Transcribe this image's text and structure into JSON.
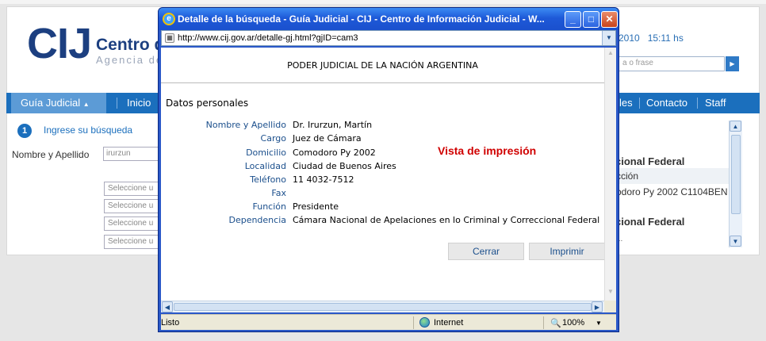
{
  "background": {
    "logo_mark": "CIJ",
    "logo_title": "Centro d",
    "logo_subtitle": "Agencia de",
    "date_partial": "2010",
    "time": "15:11 hs",
    "search_placeholder": "a o frase",
    "nav": {
      "active": "Guía Judicial",
      "items": [
        "Inicio",
        "les",
        "Contacto",
        "Staff"
      ]
    },
    "step": {
      "number": "1",
      "label": "Ingrese su búsqueda"
    },
    "name_field": {
      "label": "Nombre y Apellido",
      "value": "irurzun"
    },
    "selects": [
      "Seleccione u",
      "Seleccione u",
      "Seleccione u",
      "Seleccione u"
    ],
    "results": {
      "heading1": "cional Federal",
      "row1": "cción",
      "row2": "odoro Py 2002 C1104BEN",
      "heading2": "cional Federal",
      "row3": "..."
    }
  },
  "popup": {
    "title": "Detalle de la búsqueda - Guía Judicial - CIJ - Centro de Información Judicial - W...",
    "url": "http://www.cij.gov.ar/detalle-gj.html?gjID=cam3",
    "header": "PODER JUDICIAL DE LA NACIÓN ARGENTINA",
    "section": "Datos personales",
    "fields": [
      {
        "label": "Nombre y Apellido",
        "value": "Dr. Irurzun, Martín"
      },
      {
        "label": "Cargo",
        "value": "Juez de Cámara"
      },
      {
        "label": "Domicilio",
        "value": "Comodoro Py 2002"
      },
      {
        "label": "Localidad",
        "value": "Ciudad de Buenos Aires"
      },
      {
        "label": "Teléfono",
        "value": "11 4032-7512"
      },
      {
        "label": "Fax",
        "value": ""
      },
      {
        "label": "Función",
        "value": "Presidente"
      },
      {
        "label": "Dependencia",
        "value": "Cámara Nacional de Apelaciones en lo Criminal y Correccional Federal"
      }
    ],
    "print_view": "Vista de impresión",
    "buttons": {
      "close": "Cerrar",
      "print": "Imprimir"
    },
    "status": {
      "left": "Listo",
      "zone": "Internet",
      "zoom": "100%"
    }
  }
}
